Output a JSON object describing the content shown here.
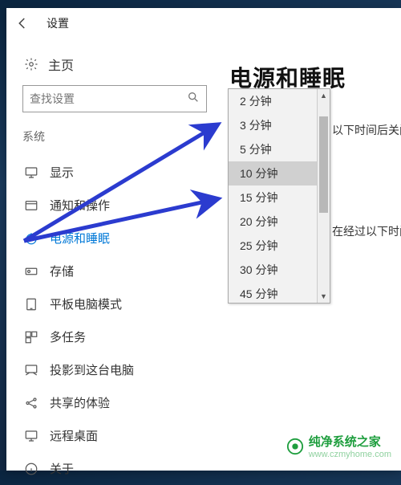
{
  "window": {
    "title": "设置"
  },
  "sidebar": {
    "home_label": "主页",
    "search_placeholder": "查找设置",
    "section_label": "系统"
  },
  "nav_items": [
    {
      "id": "display",
      "label": "显示"
    },
    {
      "id": "notifications",
      "label": "通知和操作"
    },
    {
      "id": "power-sleep",
      "label": "电源和睡眠"
    },
    {
      "id": "storage",
      "label": "存储"
    },
    {
      "id": "tablet",
      "label": "平板电脑模式"
    },
    {
      "id": "multitask",
      "label": "多任务"
    },
    {
      "id": "projecting",
      "label": "投影到这台电脑"
    },
    {
      "id": "shared",
      "label": "共享的体验"
    },
    {
      "id": "remote",
      "label": "远程桌面"
    },
    {
      "id": "about",
      "label": "关于"
    }
  ],
  "content": {
    "heading": "电源和睡眠",
    "text1": "以下时间后关闭",
    "text2": "在经过以下时间后"
  },
  "dropdown": {
    "options": [
      {
        "label": "2 分钟"
      },
      {
        "label": "3 分钟"
      },
      {
        "label": "5 分钟"
      },
      {
        "label": "10 分钟",
        "selected": true
      },
      {
        "label": "15 分钟"
      },
      {
        "label": "20 分钟"
      },
      {
        "label": "25 分钟"
      },
      {
        "label": "30 分钟"
      },
      {
        "label": "45 分钟"
      }
    ]
  },
  "annotation": {
    "arrow_color": "#2b3bcf"
  },
  "watermark": {
    "name": "纯净系统之家",
    "url": "www.czmyhome.com"
  }
}
